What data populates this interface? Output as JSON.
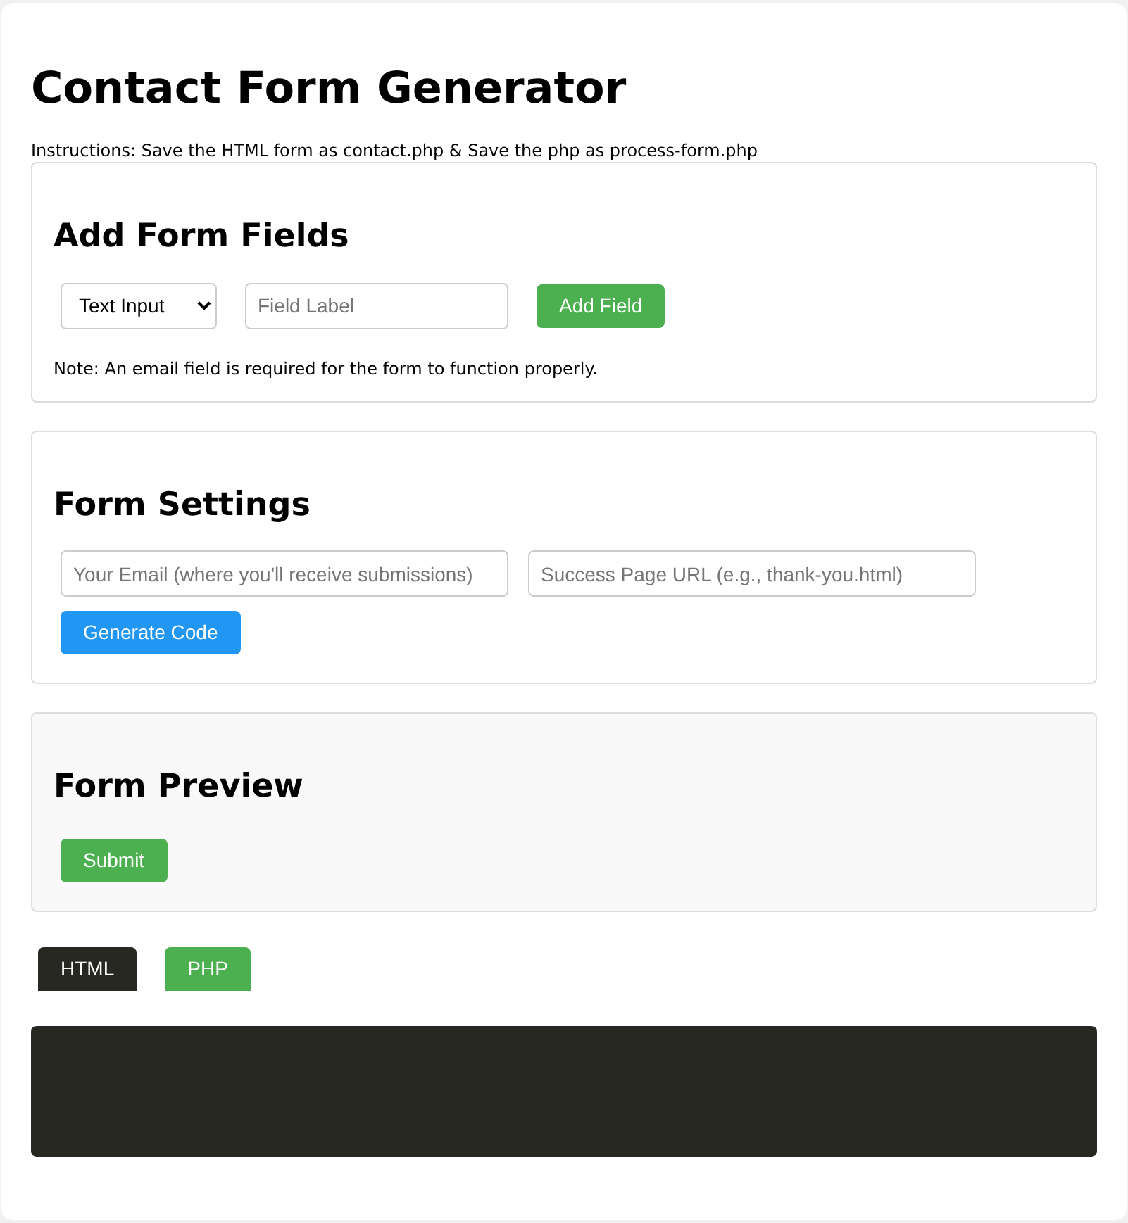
{
  "title": "Contact Form Generator",
  "instructions": "Instructions: Save the HTML form as contact.php & Save the php as process-form.php",
  "add_fields": {
    "heading": "Add Form Fields",
    "type_select": {
      "value": "Text Input"
    },
    "label_field": {
      "placeholder": "Field Label"
    },
    "add_button": "Add Field",
    "note": "Note: An email field is required for the form to function properly."
  },
  "settings": {
    "heading": "Form Settings",
    "email_field": {
      "placeholder": "Your Email (where you'll receive submissions)"
    },
    "url_field": {
      "placeholder": "Success Page URL (e.g., thank-you.html)"
    },
    "generate_button": "Generate Code"
  },
  "preview": {
    "heading": "Form Preview",
    "submit_button": "Submit"
  },
  "tabs": [
    {
      "label": "HTML",
      "selected": true
    },
    {
      "label": "PHP",
      "selected": false
    }
  ]
}
